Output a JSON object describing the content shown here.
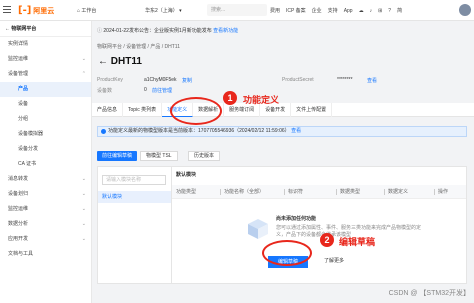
{
  "topbar": {
    "logo_text": "阿里云",
    "workspace": "工作台",
    "region": "华东2（上海）",
    "search_placeholder": "搜索...",
    "links": [
      "费用",
      "ICP 备案",
      "企业",
      "支持",
      "App"
    ]
  },
  "sidebar": {
    "title": "物联网平台",
    "items": [
      {
        "label": "实例详情",
        "sub": false,
        "active": false,
        "arrow": ""
      },
      {
        "label": "监控运维",
        "sub": false,
        "active": false,
        "arrow": "⌄"
      },
      {
        "label": "设备管理",
        "sub": false,
        "active": false,
        "arrow": "⌃"
      },
      {
        "label": "产品",
        "sub": true,
        "active": true,
        "arrow": ""
      },
      {
        "label": "设备",
        "sub": true,
        "active": false,
        "arrow": ""
      },
      {
        "label": "分组",
        "sub": true,
        "active": false,
        "arrow": ""
      },
      {
        "label": "设备模拟器",
        "sub": true,
        "active": false,
        "arrow": ""
      },
      {
        "label": "设备分发",
        "sub": true,
        "active": false,
        "arrow": ""
      },
      {
        "label": "CA 证书",
        "sub": true,
        "active": false,
        "arrow": ""
      },
      {
        "label": "消息转发",
        "sub": false,
        "active": false,
        "arrow": "⌄"
      },
      {
        "label": "设备划归",
        "sub": false,
        "active": false,
        "arrow": "⌄"
      },
      {
        "label": "监控运维",
        "sub": false,
        "active": false,
        "arrow": "⌄"
      },
      {
        "label": "数据分析",
        "sub": false,
        "active": false,
        "arrow": "⌄"
      },
      {
        "label": "应用开发",
        "sub": false,
        "active": false,
        "arrow": "⌄"
      },
      {
        "label": "文档与工具",
        "sub": false,
        "active": false,
        "arrow": ""
      }
    ]
  },
  "notice_top": "2024-01-22发布公告：企业版实例1月新功能发布",
  "notice_top_link": "查看新功能",
  "breadcrumb": "物联网平台  /  设备管理  /  产品  /  DHT11",
  "page_title": "DHT11",
  "meta": {
    "product_key_label": "ProductKey",
    "product_key_value": "a1ChyM0F5ek",
    "copy": "复制",
    "product_secret_label": "ProductSecret",
    "product_secret_value": "********",
    "view": "查看",
    "devices_label": "设备数",
    "devices_value": "0",
    "devices_link": "前往管理"
  },
  "tabs": [
    "产品信息",
    "Topic 类列表",
    "功能定义",
    "数据解析",
    "服务端订阅",
    "设备开发",
    "文件上传配置"
  ],
  "notice": "功能定义最新的物模型版本是当前版本：1707705546936（2024/02/12 11:59:06）",
  "notice_link": "查看",
  "buttons": {
    "edit_draft": "前往编辑草稿",
    "tsl": "物模型 TSL",
    "history": "历史版本"
  },
  "panel": {
    "search_placeholder": "请输入模块名称",
    "default_module": "默认模块",
    "head": "默认模块",
    "columns": [
      "功能类型",
      "功能名称（全部）",
      "标识符",
      "数据类型",
      "数据定义",
      "操作"
    ],
    "empty_title": "尚未添加任何功能",
    "empty_desc": "您可以通过添加属性、事件、服务三类功能来完成产品物模型的定义，产品下的设备都会继承该模型",
    "edit_draft_button": "编辑草稿",
    "learn_more": "了解更多"
  },
  "annotations": {
    "one_num": "1",
    "one_text": "功能定义",
    "two_num": "2",
    "two_text": "编辑草稿",
    "color": "#e8271c"
  },
  "watermark": "CSDN @ 【STM32开发】"
}
